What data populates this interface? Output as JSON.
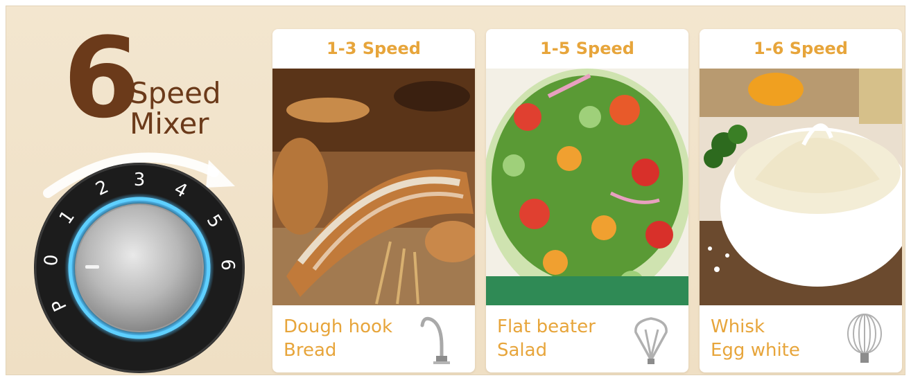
{
  "headline": {
    "number": "6",
    "word1": "Speed",
    "word2": "Mixer"
  },
  "dial": {
    "labels": [
      "P",
      "0",
      "1",
      "2",
      "3",
      "4",
      "5",
      "6"
    ],
    "ring_color": "#4fc3ff",
    "body_color": "#1c1c1c"
  },
  "cards": [
    {
      "title": "1-3 Speed",
      "attachment": "Dough hook",
      "food": "Bread",
      "icon": "dough-hook-icon"
    },
    {
      "title": "1-5 Speed",
      "attachment": "Flat beater",
      "food": "Salad",
      "icon": "flat-beater-icon"
    },
    {
      "title": "1-6 Speed",
      "attachment": "Whisk",
      "food": "Egg white",
      "icon": "whisk-icon"
    }
  ],
  "colors": {
    "accent": "#e7a53b",
    "brown": "#6b3a1a",
    "background": "#f1e3ca"
  }
}
